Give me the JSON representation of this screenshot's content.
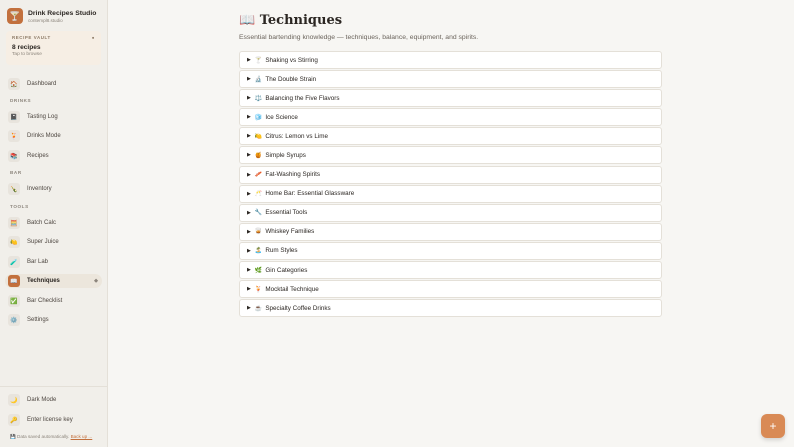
{
  "brand": {
    "icon": "cocktail-glass-icon",
    "glyph": "🍸",
    "title": "Drink Recipes Studio",
    "subtitle": "contempl8.studio"
  },
  "vault": {
    "label": "RECIPE VAULT",
    "count": "8 recipes",
    "subtitle": "Tap to browse"
  },
  "nav": {
    "dashboard": {
      "label": "Dashboard",
      "icon": "home-icon",
      "glyph": "🏠"
    },
    "section_drinks": "DRINKS",
    "tasting_log": {
      "label": "Tasting Log",
      "icon": "notebook-icon",
      "glyph": "📓"
    },
    "drinks_mode": {
      "label": "Drinks Mode",
      "icon": "cocktail-icon",
      "glyph": "🍹"
    },
    "recipes": {
      "label": "Recipes",
      "icon": "books-icon",
      "glyph": "📚"
    },
    "section_bar": "BAR",
    "inventory": {
      "label": "Inventory",
      "icon": "bottle-icon",
      "glyph": "🍾"
    },
    "section_tools": "TOOLS",
    "batch_calc": {
      "label": "Batch Calc",
      "icon": "calculator-icon",
      "glyph": "🧮"
    },
    "super_juice": {
      "label": "Super Juice",
      "icon": "lemon-icon",
      "glyph": "🍋"
    },
    "bar_lab": {
      "label": "Bar Lab",
      "icon": "test-tube-icon",
      "glyph": "🧪"
    },
    "techniques": {
      "label": "Techniques",
      "icon": "book-icon",
      "glyph": "📖",
      "marker": "◆"
    },
    "bar_checklist": {
      "label": "Bar Checklist",
      "icon": "checkbox-icon",
      "glyph": "✅"
    },
    "settings": {
      "label": "Settings",
      "icon": "gear-icon",
      "glyph": "⚙️"
    }
  },
  "footer": {
    "dark_mode": {
      "label": "Dark Mode",
      "icon": "moon-icon",
      "glyph": "🌙"
    },
    "license": {
      "label": "Enter license key",
      "icon": "key-icon",
      "glyph": "🔑"
    },
    "autosave_icon": "save-icon",
    "autosave_glyph": "💾",
    "autosave_text": "Data saved automatically.",
    "backup_link": "Back up ..."
  },
  "page": {
    "title_icon": "open-book-icon",
    "title_glyph": "📖",
    "title": "Techniques",
    "subtitle": "Essential bartending knowledge — techniques, balance, equipment, and spirits."
  },
  "techniques": [
    {
      "glyph": "🍸",
      "icon": "cocktail-glass-icon",
      "label": "Shaking vs Stirring"
    },
    {
      "glyph": "🔬",
      "icon": "microscope-icon",
      "label": "The Double Strain"
    },
    {
      "glyph": "⚖️",
      "icon": "scales-icon",
      "label": "Balancing the Five Flavors"
    },
    {
      "glyph": "🧊",
      "icon": "ice-cube-icon",
      "label": "Ice Science"
    },
    {
      "glyph": "🍋",
      "icon": "lemon-icon",
      "label": "Citrus: Lemon vs Lime"
    },
    {
      "glyph": "🍯",
      "icon": "honey-pot-icon",
      "label": "Simple Syrups"
    },
    {
      "glyph": "🥓",
      "icon": "bacon-icon",
      "label": "Fat-Washing Spirits"
    },
    {
      "glyph": "🥂",
      "icon": "champagne-glasses-icon",
      "label": "Home Bar: Essential Glassware"
    },
    {
      "glyph": "🔧",
      "icon": "wrench-icon",
      "label": "Essential Tools"
    },
    {
      "glyph": "🥃",
      "icon": "tumbler-glass-icon",
      "label": "Whiskey Families"
    },
    {
      "glyph": "🏝️",
      "icon": "island-icon",
      "label": "Rum Styles"
    },
    {
      "glyph": "🌿",
      "icon": "herb-icon",
      "label": "Gin Categories"
    },
    {
      "glyph": "🍹",
      "icon": "tropical-drink-icon",
      "label": "Mocktail Technique"
    },
    {
      "glyph": "☕",
      "icon": "coffee-icon",
      "label": "Specialty Coffee Drinks"
    }
  ],
  "fab": {
    "icon": "plus-icon",
    "glyph": "+"
  },
  "colors": {
    "accent": "#c2703d",
    "fab": "#d98a55",
    "sidebar_bg": "#f1efea",
    "main_bg": "#f7f6f3"
  }
}
